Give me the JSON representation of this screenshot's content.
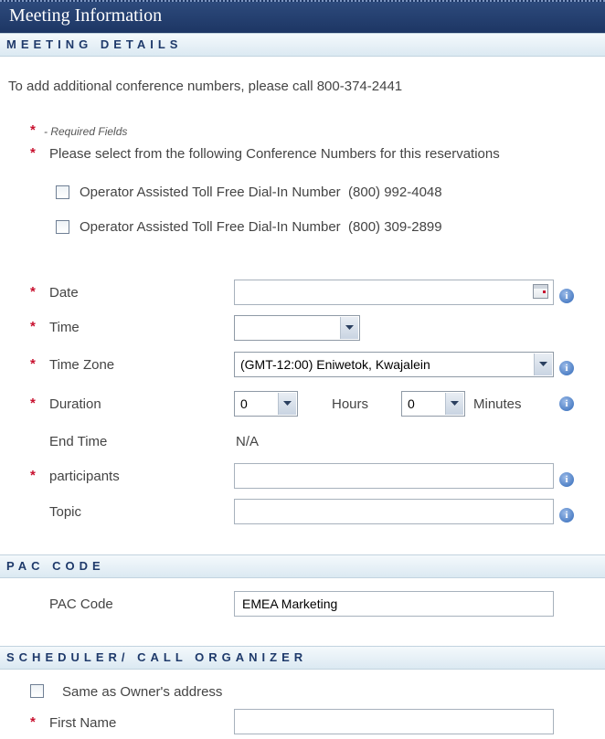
{
  "title": "Meeting Information",
  "sections": {
    "meeting_details": "MEETING DETAILS",
    "pac_code": "PAC CODE",
    "scheduler": "SCHEDULER/ CALL ORGANIZER"
  },
  "intro": "To add additional conference numbers, please call 800-374-2441",
  "required": {
    "star": "*",
    "note": "- Required Fields"
  },
  "select_prompt": "Please select from the following Conference Numbers for this reservations",
  "conference_numbers": [
    {
      "label": "Operator Assisted Toll Free Dial-In Number",
      "number": "(800) 992-4048",
      "checked": false
    },
    {
      "label": "Operator Assisted Toll Free Dial-In Number",
      "number": "(800) 309-2899",
      "checked": false
    }
  ],
  "fields": {
    "date": {
      "label": "Date",
      "value": ""
    },
    "time": {
      "label": "Time",
      "value": ""
    },
    "time_zone": {
      "label": "Time Zone",
      "value": "(GMT-12:00) Eniwetok, Kwajalein"
    },
    "duration": {
      "label": "Duration",
      "hours_value": "0",
      "hours_label": "Hours",
      "minutes_value": "0",
      "minutes_label": "Minutes"
    },
    "end_time": {
      "label": "End Time",
      "value": "N/A"
    },
    "participants": {
      "label": "participants",
      "value": ""
    },
    "topic": {
      "label": "Topic",
      "value": ""
    }
  },
  "pac": {
    "label": "PAC Code",
    "value": "EMEA Marketing"
  },
  "scheduler": {
    "same_as_owner": "Same as Owner's address",
    "first_name_label": "First Name",
    "first_name_value": ""
  },
  "icons": {
    "info": "i"
  },
  "colors": {
    "title_bar": "#1d3664",
    "section_text": "#1f3a6b",
    "required_star": "#c8102e",
    "info_icon": "#2f68b8"
  }
}
